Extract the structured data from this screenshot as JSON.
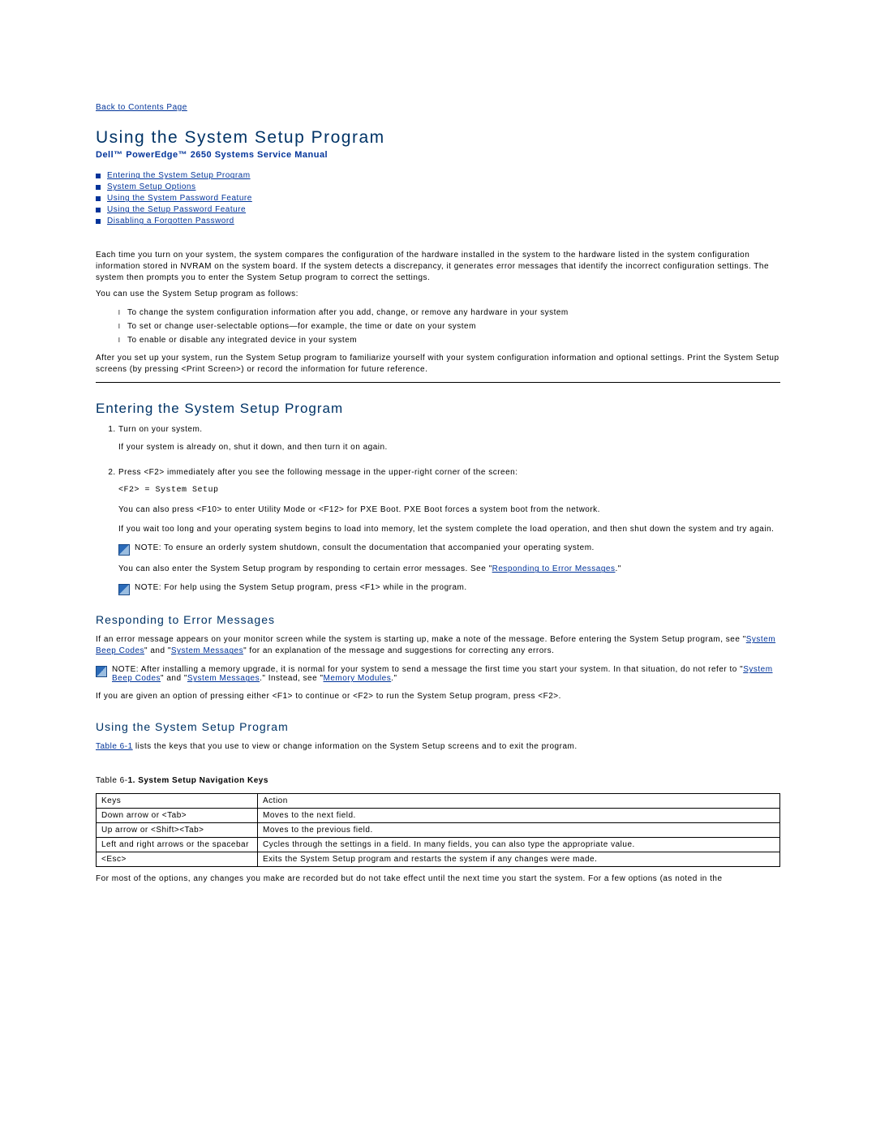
{
  "nav": {
    "back": "Back to Contents Page"
  },
  "title": "Using the System Setup Program",
  "subtitle": "Dell™ PowerEdge™ 2650 Systems Service Manual",
  "toc": {
    "i0": "Entering the System Setup Program",
    "i1": "System Setup Options",
    "i2": "Using the System Password Feature",
    "i3": "Using the Setup Password Feature",
    "i4": "Disabling a Forgotten Password"
  },
  "intro": {
    "p1": "Each time you turn on your system, the system compares the configuration of the hardware installed in the system to the hardware listed in the system configuration information stored in NVRAM on the system board. If the system detects a discrepancy, it generates error messages that identify the incorrect configuration settings. The system then prompts you to enter the System Setup program to correct the settings.",
    "p2": "You can use the System Setup program as follows:",
    "li1": "To change the system configuration information after you add, change, or remove any hardware in your system",
    "li2": "To set or change user-selectable options—for example, the time or date on your system",
    "li3": "To enable or disable any integrated device in your system",
    "p3": "After you set up your system, run the System Setup program to familiarize yourself with your system configuration information and optional settings. Print the System Setup screens (by pressing <Print Screen>) or record the information for future reference."
  },
  "enter": {
    "heading": "Entering the System Setup Program",
    "s1": "Turn on your system.",
    "s1b": "If your system is already on, shut it down, and then turn it on again.",
    "s2": "Press <F2> immediately after you see the following message in the upper-right corner of the screen:",
    "code": "<F2> = System Setup",
    "p1": "You can also press <F10> to enter Utility Mode or <F12> for PXE Boot. PXE Boot forces a system boot from the network.",
    "p2": "If you wait too long and your operating system begins to load into memory, let the system complete the load operation, and then shut down the system and try again.",
    "note1": "NOTE: To ensure an orderly system shutdown, consult the documentation that accompanied your operating system.",
    "p3a": "You can also enter the System Setup program by responding to certain error messages. See \"",
    "p3link": "Responding to Error Messages",
    "p3b": ".\"",
    "note2": "NOTE: For help using the System Setup program, press <F1> while in the program."
  },
  "respond": {
    "heading": "Responding to Error Messages",
    "p1a": "If an error message appears on your monitor screen while the system is starting up, make a note of the message. Before entering the System Setup program, see \"",
    "link1": "System Beep Codes",
    "p1b": "\" and \"",
    "link2": "System Messages",
    "p1c": "\" for an explanation of the message and suggestions for correcting any errors.",
    "note_a": "NOTE: After installing a memory upgrade, it is normal for your system to send a message the first time you start your system. In that situation, do not refer to \"",
    "note_l1": "System Beep Codes",
    "note_b": "\" and \"",
    "note_l2": "System Messages",
    "note_c": ".\" Instead, see \"",
    "note_l3": "Memory Modules",
    "note_d": ".\"",
    "p2": "If you are given an option of pressing either <F1> to continue or <F2> to run the System Setup program, press <F2>."
  },
  "using": {
    "heading": "Using the System Setup Program",
    "p1a": "",
    "link1": "Table 6-1",
    "p1b": " lists the keys that you use to view or change information on the System Setup screens and to exit the program.",
    "caption_a": "Table 6-",
    "caption_b": "1. System Setup Navigation Keys",
    "th1": "Keys",
    "th2": "Action",
    "r1k": "Down arrow or <Tab>",
    "r1a": "Moves to the next field.",
    "r2k": "Up arrow or <Shift><Tab>",
    "r2a": "Moves to the previous field.",
    "r3k": "Left and right arrows or the spacebar",
    "r3a": "Cycles through the settings in a field. In many fields, you can also type the appropriate value.",
    "r4k": "<Esc>",
    "r4a": "Exits the System Setup program and restarts the system if any changes were made.",
    "p2": "For most of the options, any changes you make are recorded but do not take effect until the next time you start the system. For a few options (as noted in the"
  }
}
